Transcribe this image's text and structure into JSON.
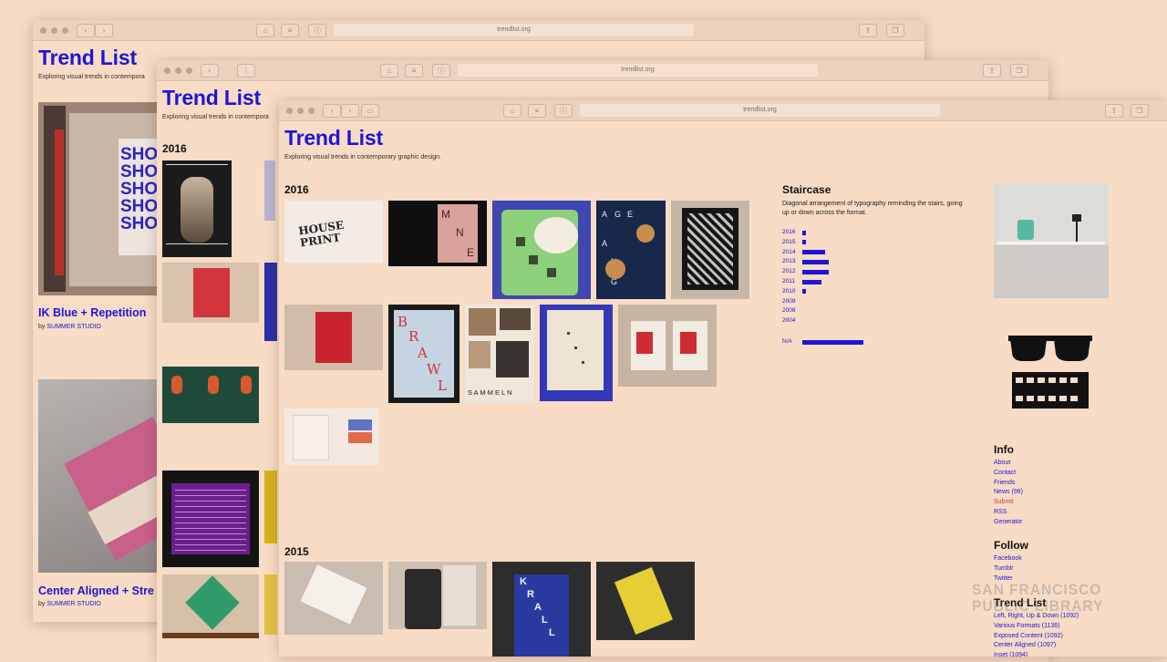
{
  "site": {
    "url": "trendlist.org",
    "title": "Trend List",
    "tagline": "Exploring visual trends in contemporary graphic design.",
    "tagline_cut": "Exploring visual trends in contempora"
  },
  "back_window": {
    "post1": {
      "title": "IK Blue + Repetition",
      "by": "by",
      "author": "SUMMER STUDIO"
    },
    "post2": {
      "title": "Center Aligned + Stre",
      "by": "by",
      "author": "SUMMER STUDIO"
    },
    "poster_word": "SHO"
  },
  "mid_window": {
    "year": "2016"
  },
  "front_window": {
    "years": [
      "2016",
      "2015"
    ],
    "poster_letters": {
      "mne": [
        "M",
        "N",
        "E"
      ],
      "age": [
        "A",
        "G",
        "E",
        "A",
        "N",
        "G"
      ],
      "brawl": [
        "B",
        "R",
        "A",
        "W",
        "L"
      ],
      "sammeln": "S A M M E L N",
      "krall": [
        "K",
        "R",
        "A",
        "L",
        "L"
      ],
      "print": "HOUSE PRINT"
    }
  },
  "sidebar": {
    "heading": "Staircase",
    "description": "Diagonal arrangement of typography reminding the stairs, going up or down across the format.",
    "chart_data": {
      "type": "bar",
      "categories": [
        "2016",
        "2015",
        "2014",
        "2013",
        "2012",
        "2011",
        "2010",
        "2009",
        "2008",
        "2004",
        "N/A"
      ],
      "values": [
        1,
        1,
        6,
        7,
        7,
        5,
        1,
        0,
        0,
        0,
        16
      ]
    },
    "info_heading": "Info",
    "info_links": [
      "About",
      "Contact",
      "Friends",
      "News (98)",
      "Submit",
      "RSS",
      "Generator"
    ],
    "info_hot_index": 4,
    "follow_heading": "Follow",
    "follow_links": [
      "Facebook",
      "Tumblr",
      "Twitter"
    ],
    "list_heading": "Trend List",
    "list_links": [
      "Left, Right, Up & Down (1092)",
      "Various Formats (1136)",
      "Exposed Content (1092)",
      "Center Aligned (1097)",
      "Inset (1094)"
    ]
  },
  "watermark": {
    "line1": "SAN FRANCISCO",
    "line2": "PUBLIC LIBRARY"
  },
  "colors": {
    "accent": "#1d16d4",
    "background": "#f8dcc6",
    "submit": "#d8332c"
  }
}
